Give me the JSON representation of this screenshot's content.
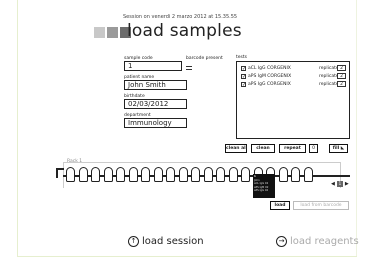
{
  "session_line": "Session on venerdi 2 marzo 2012 at 15.35.55",
  "title": "load samples",
  "header_squares": [
    "#c8c8c8",
    "#9a9a9a",
    "#6c6c6c"
  ],
  "form": {
    "sample_code_label": "sample code",
    "sample_code_value": "1",
    "barcode_label": "barcode present",
    "patient_label": "patient name",
    "patient_value": "John Smith",
    "birthdate_label": "birthdate",
    "birthdate_value": "02/03/2012",
    "department_label": "department",
    "department_value": "Immunology"
  },
  "tests": {
    "label": "tests",
    "items": [
      {
        "checked": true,
        "name": "aCL IgG CORGENIX",
        "replicates_label": "replicates",
        "replicates": "2"
      },
      {
        "checked": true,
        "name": "aPS IgM CORGENIX",
        "replicates_label": "replicates",
        "replicates": "2"
      },
      {
        "checked": true,
        "name": "aPS IgG CORGENIX",
        "replicates_label": "replicates",
        "replicates": "2"
      }
    ]
  },
  "toolbar": {
    "clean_all": "clean all",
    "clean": "clean",
    "repeat": "repeat",
    "repeat_count": "0",
    "fill": "fill"
  },
  "rack": {
    "label": "Rack 1",
    "popup_lines": [
      "1",
      "John",
      "aCL IgG 02",
      "aPS IgM 02",
      "aPS IgG 02"
    ]
  },
  "pager": {
    "prev": "◀",
    "page": "1",
    "next": "▶"
  },
  "load_buttons": {
    "load": "load",
    "load_barcode": "load from barcode"
  },
  "footer": {
    "load_session": "load session",
    "load_reagents": "load reagents"
  },
  "colors": {
    "footer_disabled": "#aaaaaa",
    "footer_active": "#222222"
  }
}
